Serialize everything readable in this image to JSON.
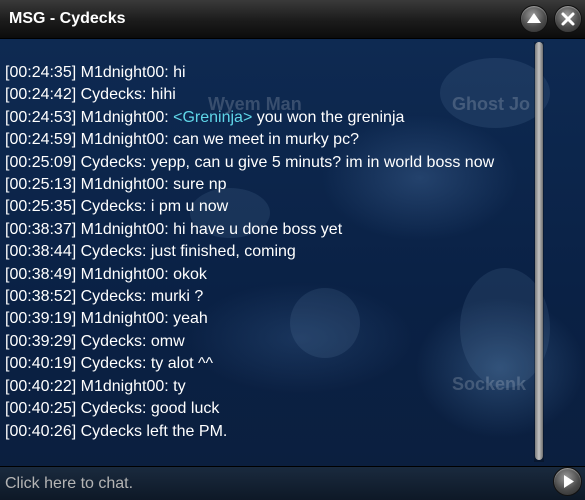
{
  "window": {
    "title": "MSG - Cydecks"
  },
  "titlebar_buttons": {
    "scroll_up_icon": "triangle-up-icon",
    "close_icon": "close-x-icon"
  },
  "background_labels": [
    "Wyem Man",
    "Ghost Jo",
    "Sockenk"
  ],
  "messages": [
    {
      "text": "[00:24:35] M1dnight00: hi"
    },
    {
      "text": "[00:24:42] Cydecks: hihi"
    },
    {
      "before": "[00:24:53] M1dnight00: ",
      "highlight": "<Greninja>",
      "after": " you won the greninja"
    },
    {
      "text": "[00:24:59] M1dnight00: can we meet in murky pc?"
    },
    {
      "text": "[00:25:09] Cydecks: yepp, can u give 5 minuts? im in world boss now"
    },
    {
      "text": "[00:25:13] M1dnight00: sure np"
    },
    {
      "text": "[00:25:35] Cydecks: i pm u now"
    },
    {
      "text": "[00:38:37] M1dnight00: hi have u done boss yet"
    },
    {
      "text": "[00:38:44] Cydecks: just finished, coming"
    },
    {
      "text": "[00:38:49] M1dnight00: okok"
    },
    {
      "text": "[00:38:52] Cydecks: murki ?"
    },
    {
      "text": "[00:39:19] M1dnight00: yeah"
    },
    {
      "text": "[00:39:29] Cydecks: omw"
    },
    {
      "text": "[00:40:19] Cydecks: ty alot ^^"
    },
    {
      "text": "[00:40:22] M1dnight00: ty"
    },
    {
      "text": "[00:40:25] Cydecks: good luck"
    },
    {
      "text": "[00:40:26] Cydecks left the PM."
    }
  ],
  "input": {
    "placeholder": "Click here to chat.",
    "value": ""
  },
  "send_button": {
    "icon": "triangle-right-icon"
  },
  "colors": {
    "highlight": "#5fd6e8",
    "text": "#ffffff",
    "panel": "#0d2448"
  }
}
